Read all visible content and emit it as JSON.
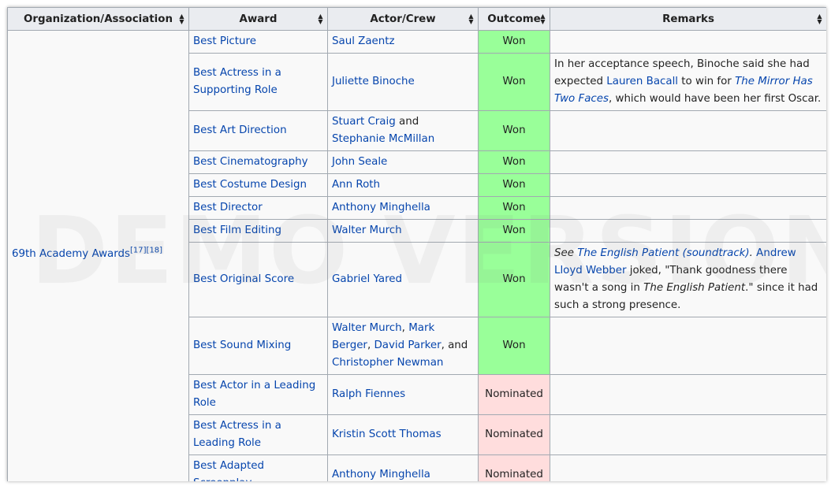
{
  "headers": [
    "Organization/Association",
    "Award",
    "Actor/Crew",
    "Outcome",
    "Remarks"
  ],
  "organization": {
    "name": "69th Academy Awards",
    "refs": [
      "[17]",
      "[18]"
    ]
  },
  "watermark": "DEMO VERSION",
  "rows": [
    {
      "award": "Best Picture",
      "crew": [
        {
          "t": "Saul Zaentz",
          "link": true
        }
      ],
      "outcome": "Won"
    },
    {
      "award": "Best Actress in a Supporting Role",
      "crew": [
        {
          "t": "Juliette Binoche",
          "link": true
        }
      ],
      "outcome": "Won",
      "remarks": [
        {
          "t": "In her acceptance speech, Binoche said she had expected "
        },
        {
          "t": "Lauren Bacall",
          "link": true
        },
        {
          "t": " to win for "
        },
        {
          "t": "The Mirror Has Two Faces",
          "link": true,
          "italic": true
        },
        {
          "t": ", which would have been her first Oscar."
        }
      ]
    },
    {
      "award": "Best Art Direction",
      "crew": [
        {
          "t": "Stuart Craig",
          "link": true
        },
        {
          "t": " and "
        },
        {
          "t": "Stephanie McMillan",
          "link": true
        }
      ],
      "outcome": "Won"
    },
    {
      "award": "Best Cinematography",
      "crew": [
        {
          "t": "John Seale",
          "link": true
        }
      ],
      "outcome": "Won"
    },
    {
      "award": "Best Costume Design",
      "crew": [
        {
          "t": "Ann Roth",
          "link": true
        }
      ],
      "outcome": "Won"
    },
    {
      "award": "Best Director",
      "crew": [
        {
          "t": "Anthony Minghella",
          "link": true
        }
      ],
      "outcome": "Won"
    },
    {
      "award": "Best Film Editing",
      "crew": [
        {
          "t": "Walter Murch",
          "link": true
        }
      ],
      "outcome": "Won"
    },
    {
      "award": "Best Original Score",
      "crew": [
        {
          "t": "Gabriel Yared",
          "link": true
        }
      ],
      "outcome": "Won",
      "remarks": [
        {
          "t": "See ",
          "italic": true
        },
        {
          "t": "The English Patient (soundtrack)",
          "link": true,
          "italic": true
        },
        {
          "t": ". ",
          "italic": true
        },
        {
          "t": "Andrew Lloyd Webber",
          "link": true
        },
        {
          "t": " joked, \"Thank goodness there wasn't a song in "
        },
        {
          "t": "The English Patient",
          "italic": true
        },
        {
          "t": ".\" since it had such a strong presence."
        }
      ]
    },
    {
      "award": "Best Sound Mixing",
      "crew": [
        {
          "t": "Walter Murch",
          "link": true
        },
        {
          "t": ", "
        },
        {
          "t": "Mark Berger",
          "link": true
        },
        {
          "t": ", "
        },
        {
          "t": "David Parker",
          "link": true
        },
        {
          "t": ", and "
        },
        {
          "t": "Christopher Newman",
          "link": true
        }
      ],
      "outcome": "Won"
    },
    {
      "award": "Best Actor in a Leading Role",
      "crew": [
        {
          "t": "Ralph Fiennes",
          "link": true
        }
      ],
      "outcome": "Nominated"
    },
    {
      "award": "Best Actress in a Leading Role",
      "crew": [
        {
          "t": "Kristin Scott Thomas",
          "link": true
        }
      ],
      "outcome": "Nominated"
    },
    {
      "award": "Best Adapted Screenplay",
      "crew": [
        {
          "t": "Anthony Minghella",
          "link": true
        }
      ],
      "outcome": "Nominated"
    }
  ]
}
